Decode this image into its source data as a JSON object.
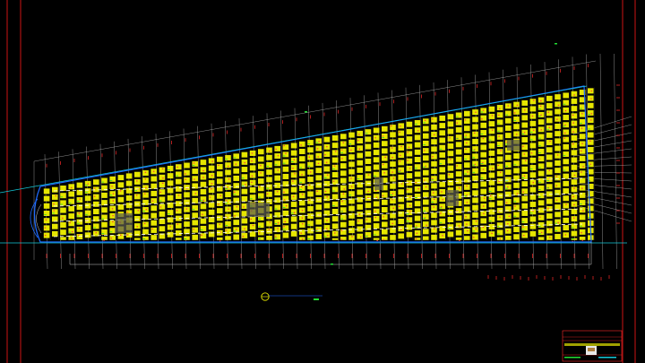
{
  "app": {
    "kind": "CAD drawing viewport",
    "background_color": "#000000"
  },
  "drawing": {
    "colors": {
      "sheet_border": "#ff1a1a",
      "building_outline": "#1f6bff",
      "grid_lines": "#d8d8d8",
      "cells_fill": "#e6e600",
      "cells_accent": "#ff3b3b",
      "green_marks": "#22dd33",
      "cyan_line": "#13c8d8",
      "dim_markers": "#ff2b2b"
    }
  },
  "caption": {
    "label": "",
    "icon": "section-symbol-icon"
  },
  "title_block": {
    "icon": "logo-icon"
  }
}
